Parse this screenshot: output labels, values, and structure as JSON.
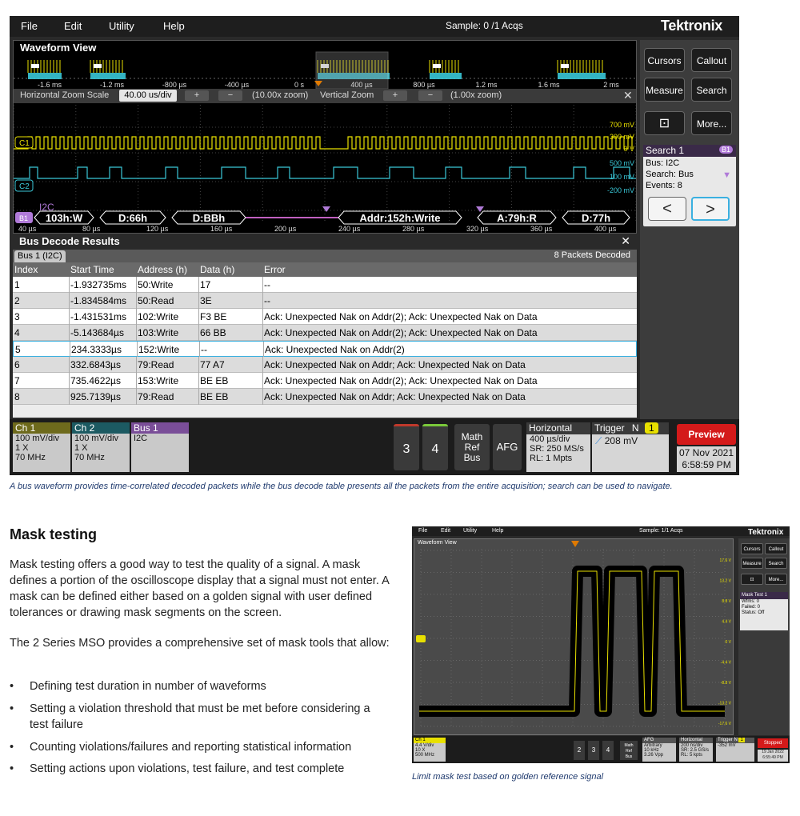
{
  "scope": {
    "menu": [
      "File",
      "Edit",
      "Utility",
      "Help"
    ],
    "sample": "Sample: 0 /1 Acqs",
    "brand": "Tektronix",
    "waveform_view": {
      "title": "Waveform View",
      "overview_ticks": [
        "-1.6 ms",
        "-1.2 ms",
        "-800 µs",
        "-400 µs",
        "0 s",
        "400 µs",
        "800 µs",
        "1.2 ms",
        "1.6 ms",
        "2 ms"
      ],
      "zoom": {
        "scale_label": "Horizontal Zoom Scale",
        "scale_value": "40.00 us/div",
        "h_zoom": "(10.00x zoom)",
        "vertical_label": "Vertical Zoom",
        "v_zoom": "(1.00x zoom)"
      },
      "ch1_label": "C1",
      "ch2_label": "C2",
      "ch1_volts": [
        "700 mV",
        "300 mV",
        "0 V"
      ],
      "ch2_volts": [
        "500 mV",
        "100 mV",
        "-200 mV"
      ],
      "bus_label": "I2C",
      "bus_tag": "B1",
      "bus_packets": [
        "103h:W",
        "D:66h",
        "D:BBh",
        "Addr:152h:Write",
        "A:79h:R",
        "D:77h"
      ],
      "zoom_ticks": [
        "40 µs",
        "80 µs",
        "120 µs",
        "160 µs",
        "200 µs",
        "240 µs",
        "280 µs",
        "320 µs",
        "360 µs",
        "400 µs"
      ]
    },
    "bus_decode": {
      "title": "Bus Decode Results",
      "close": "✕",
      "tab": "Bus 1 (I2C)",
      "packets": "8 Packets Decoded",
      "columns": [
        "Index",
        "Start Time",
        "Address (h)",
        "Data (h)",
        "Error"
      ],
      "rows": [
        [
          "1",
          "-1.932735ms",
          "50:Write",
          "17",
          "--"
        ],
        [
          "2",
          "-1.834584ms",
          "50:Read",
          "3E",
          "--"
        ],
        [
          "3",
          "-1.431531ms",
          "102:Write",
          "F3 BE",
          "Ack: Unexpected Nak on Addr(2); Ack: Unexpected Nak on Data"
        ],
        [
          "4",
          "-5.143684µs",
          "103:Write",
          "66 BB",
          "Ack: Unexpected Nak on Addr(2); Ack: Unexpected Nak on Data"
        ],
        [
          "5",
          "234.3333µs",
          "152:Write",
          "--",
          "Ack: Unexpected Nak on Addr(2)"
        ],
        [
          "6",
          "332.6843µs",
          "79:Read",
          "77 A7",
          "Ack: Unexpected Nak on Addr; Ack: Unexpected Nak on Data"
        ],
        [
          "7",
          "735.4622µs",
          "153:Write",
          "BE EB",
          "Ack: Unexpected Nak on Addr(2); Ack: Unexpected Nak on Data"
        ],
        [
          "8",
          "925.7139µs",
          "79:Read",
          "BE EB",
          "Ack: Unexpected Nak on Addr; Ack: Unexpected Nak on Data"
        ]
      ]
    },
    "side": {
      "cursors": "Cursors",
      "callout": "Callout",
      "measure": "Measure",
      "search": "Search",
      "more": "More...",
      "search_title": "Search 1",
      "search_tag": "B1",
      "search_lines": [
        "Bus: I2C",
        "Search: Bus",
        "Events: 8"
      ],
      "prev": "<",
      "next": ">"
    },
    "status": {
      "ch1": {
        "name": "Ch 1",
        "lines": [
          "100 mV/div",
          "1 X",
          "70 MHz"
        ]
      },
      "ch2": {
        "name": "Ch 2",
        "lines": [
          "100 mV/div",
          "1 X",
          "70 MHz"
        ]
      },
      "bus1": {
        "name": "Bus 1",
        "lines": [
          "I2C"
        ]
      },
      "btn3": "3",
      "btn4": "4",
      "math_ref_bus": [
        "Math",
        "Ref",
        "Bus"
      ],
      "afg": "AFG",
      "horizontal": {
        "title": "Horizontal",
        "lines": [
          "400 µs/div",
          "SR: 250 MS/s",
          "RL: 1 Mpts"
        ]
      },
      "trigger": {
        "title": "Trigger",
        "mode": "N",
        "level": "208 mV",
        "ch": "1"
      },
      "preview": "Preview",
      "date": "07 Nov 2021",
      "time": "6:58:59 PM"
    },
    "colors": {
      "ch1": "#e8e000",
      "ch2": "#3ac8d8",
      "bus": "#b07ad8",
      "accent": "#d41a1a"
    }
  },
  "caption1": "A bus waveform provides time-correlated decoded packets while the bus decode table presents all the packets from the entire acquisition; search can be used to navigate.",
  "mask": {
    "title": "Mask testing",
    "p1": "Mask testing offers a good way to test the quality of a signal. A mask defines a portion of the oscilloscope display that a signal must not enter. A mask can be defined either based on a golden signal with user defined tolerances or drawing mask segments on the screen.",
    "p2": "The 2 Series MSO provides a comprehensive set of mask tools that allow:",
    "bullets": [
      "Defining test duration in number of waveforms",
      "Setting a violation threshold that must be met before considering a test failure",
      "Counting violations/failures and reporting statistical information",
      "Setting actions upon violations, test failure, and test complete"
    ]
  },
  "scope2": {
    "menu": [
      "File",
      "Edit",
      "Utility",
      "Help"
    ],
    "sample": "Sample: 1/1 Acqs",
    "brand": "Tektronix",
    "view_title": "Waveform View",
    "volts": [
      "17.6 V",
      "13.2 V",
      "8.8 V",
      "4.4 V",
      "0 V",
      "-4.4 V",
      "-8.8 V",
      "-13.2 V",
      "-17.6 V"
    ],
    "side": {
      "cursors": "Cursors",
      "callout": "Callout",
      "measure": "Measure",
      "search": "Search",
      "more": "More...",
      "mask_title": "Mask Test 1",
      "mask_lines": [
        "Wfms: 0",
        "Failed: 0",
        "Status: Off"
      ]
    },
    "status": {
      "ch1": {
        "name": "Ch 1",
        "lines": [
          "4.4 V/div",
          "10 X",
          "500 MHz"
        ]
      },
      "nums": [
        "2",
        "3",
        "4"
      ],
      "mrb": [
        "Math",
        "Ref",
        "Bus"
      ],
      "afg": {
        "title": "AFG",
        "lines": [
          "Arbitrary",
          "10 kHz",
          "3.26 Vpp"
        ]
      },
      "horizontal": {
        "title": "Horizontal",
        "lines": [
          "200 ns/div",
          "SR: 2.5 GS/s",
          "RL: 5 kpts"
        ]
      },
      "trigger": {
        "title": "Trigger",
        "mode": "N",
        "ch": "1",
        "level": "-352 mV"
      },
      "stopped": "Stopped",
      "date": "19 Jan 2022",
      "time": "6:55:49 PM"
    }
  },
  "caption2": "Limit mask test based on golden reference signal"
}
